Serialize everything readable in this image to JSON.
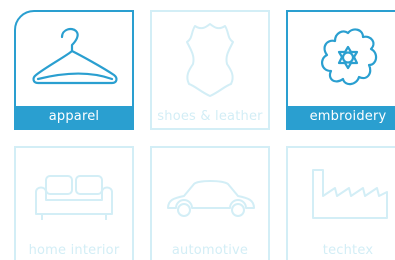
{
  "categories": [
    {
      "label": "apparel",
      "icon": "hanger-icon",
      "active": true
    },
    {
      "label": "shoes & leather",
      "icon": "leather-hide-icon",
      "active": false
    },
    {
      "label": "embroidery",
      "icon": "flower-icon",
      "active": true
    },
    {
      "label": "home interior",
      "icon": "sofa-icon",
      "active": false
    },
    {
      "label": "automotive",
      "icon": "car-icon",
      "active": false
    },
    {
      "label": "techtex",
      "icon": "factory-icon",
      "active": false
    }
  ],
  "colors": {
    "active": "#2a9fd0",
    "inactive": "#d3eef6",
    "label_text_active": "#ffffff"
  }
}
